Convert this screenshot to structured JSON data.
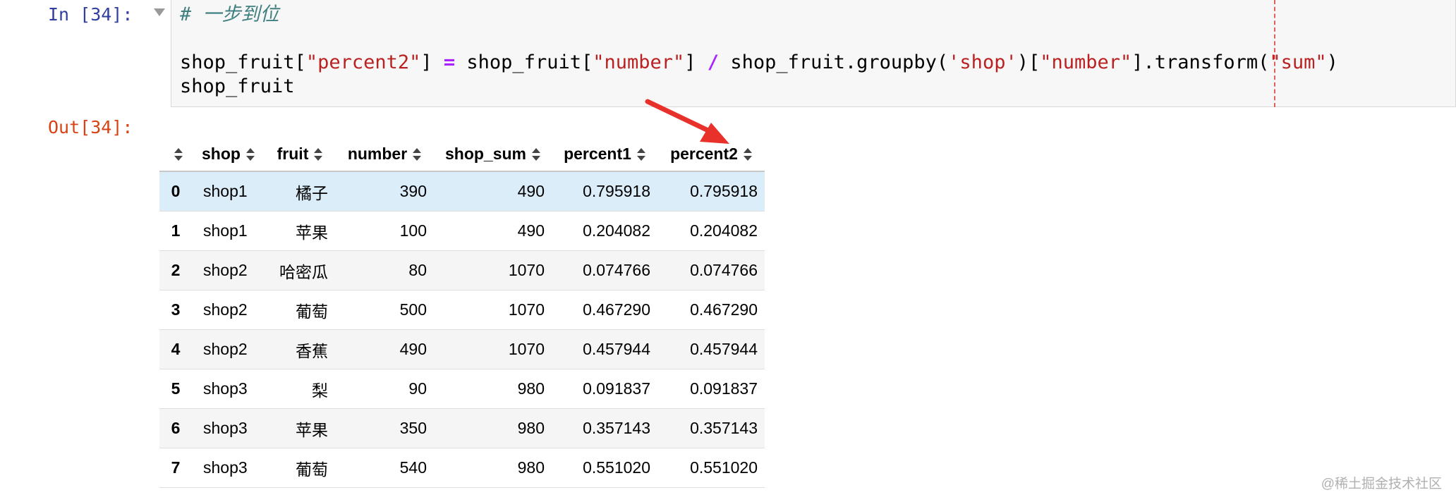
{
  "cell_in": {
    "prompt": "In [34]:",
    "code_lines": [
      "# 一步到位",
      "",
      "shop_fruit[\"percent2\"] = shop_fruit[\"number\"] / shop_fruit.groupby('shop')[\"number\"].transform(\"sum\")",
      "shop_fruit"
    ]
  },
  "cell_out": {
    "prompt": "Out[34]:",
    "columns": [
      "",
      "shop",
      "fruit",
      "number",
      "shop_sum",
      "percent1",
      "percent2"
    ],
    "rows": [
      [
        "0",
        "shop1",
        "橘子",
        "390",
        "490",
        "0.795918",
        "0.795918"
      ],
      [
        "1",
        "shop1",
        "苹果",
        "100",
        "490",
        "0.204082",
        "0.204082"
      ],
      [
        "2",
        "shop2",
        "哈密瓜",
        "80",
        "1070",
        "0.074766",
        "0.074766"
      ],
      [
        "3",
        "shop2",
        "葡萄",
        "500",
        "1070",
        "0.467290",
        "0.467290"
      ],
      [
        "4",
        "shop2",
        "香蕉",
        "490",
        "1070",
        "0.457944",
        "0.457944"
      ],
      [
        "5",
        "shop3",
        "梨",
        "90",
        "980",
        "0.091837",
        "0.091837"
      ],
      [
        "6",
        "shop3",
        "苹果",
        "350",
        "980",
        "0.357143",
        "0.357143"
      ],
      [
        "7",
        "shop3",
        "葡萄",
        "540",
        "980",
        "0.551020",
        "0.551020"
      ]
    ],
    "highlighted_row": 0
  },
  "watermark": "@稀土掘金技术社区",
  "colors": {
    "in_prompt": "#303F9F",
    "out_prompt": "#D84315",
    "string": "#BA2121",
    "operator": "#AA22FF",
    "comment": "#408080",
    "annotation_arrow": "#E8312B",
    "highlight_row": "#DCEDFA"
  }
}
